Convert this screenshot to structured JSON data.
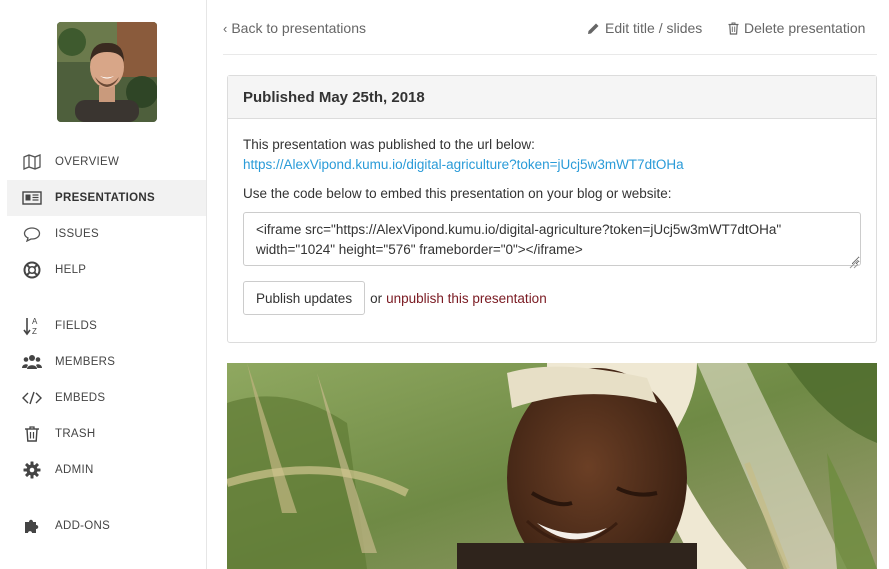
{
  "sidebar": {
    "items": [
      {
        "label": "OVERVIEW",
        "icon": "map-icon"
      },
      {
        "label": "PRESENTATIONS",
        "icon": "presentation-icon",
        "active": true
      },
      {
        "label": "ISSUES",
        "icon": "speech-bubble-icon"
      },
      {
        "label": "HELP",
        "icon": "lifebuoy-icon"
      },
      {
        "label": "FIELDS",
        "icon": "sort-az-icon"
      },
      {
        "label": "MEMBERS",
        "icon": "users-icon"
      },
      {
        "label": "EMBEDS",
        "icon": "code-icon"
      },
      {
        "label": "TRASH",
        "icon": "trash-icon"
      },
      {
        "label": "ADMIN",
        "icon": "gear-icon"
      },
      {
        "label": "ADD-ONS",
        "icon": "puzzle-icon"
      }
    ]
  },
  "topbar": {
    "back_label": "Back to presentations",
    "edit_label": "Edit title / slides",
    "delete_label": "Delete presentation"
  },
  "panel": {
    "title": "Published May 25th, 2018",
    "published_text": "This presentation was published to the url below:",
    "url": "https://AlexVipond.kumu.io/digital-agriculture?token=jUcj5w3mWT7dtOHa",
    "embed_text": "Use the code below to embed this presentation on your blog or website:",
    "embed_code": "<iframe src=\"https://AlexVipond.kumu.io/digital-agriculture?token=jUcj5w3mWT7dtOHa\" width=\"1024\" height=\"576\" frameborder=\"0\"></iframe>",
    "publish_button": "Publish updates",
    "or_text": "or",
    "unpublish_link": "unpublish this presentation"
  },
  "colors": {
    "link_blue": "#2a9bd8",
    "unpublish_red": "#7a1a22",
    "active_bg": "#f2f2f2"
  }
}
